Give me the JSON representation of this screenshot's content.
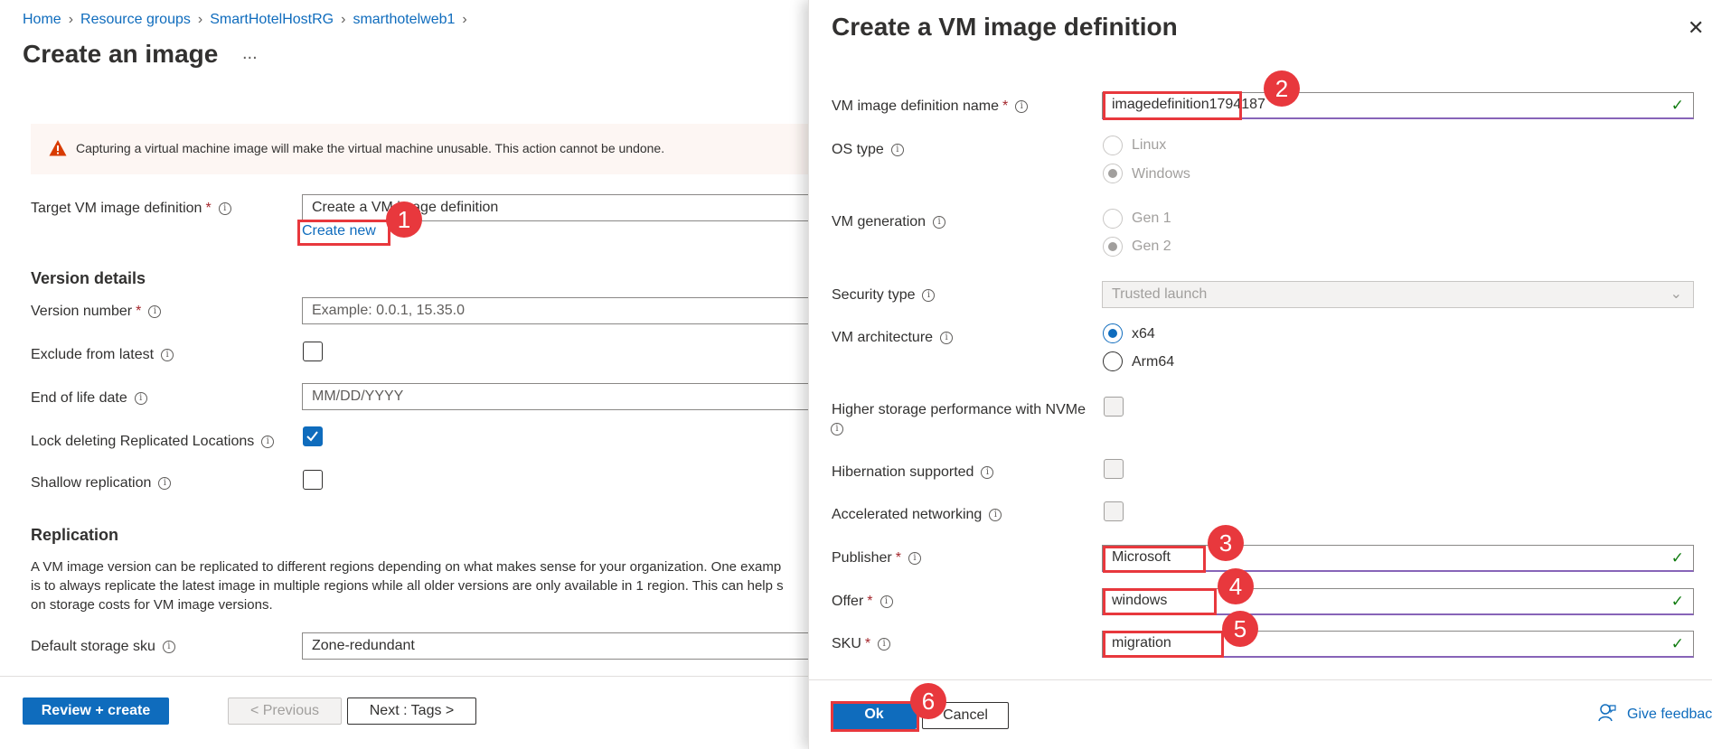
{
  "breadcrumb": [
    "Home",
    "Resource groups",
    "SmartHotelHostRG",
    "smarthotelweb1"
  ],
  "page_title": "Create an image",
  "more_icon": "...",
  "warning": "Capturing a virtual machine image will make the virtual machine unusable. This action cannot be undone.",
  "target_label": "Target VM image definition",
  "target_value": "Create a VM image definition",
  "create_new": "Create new",
  "version_heading": "Version details",
  "version_number_label": "Version number",
  "version_number_placeholder": "Example: 0.0.1, 15.35.0",
  "exclude_label": "Exclude from latest",
  "eol_label": "End of life date",
  "eol_placeholder": "MM/DD/YYYY",
  "lock_label": "Lock deleting Replicated Locations",
  "shallow_label": "Shallow replication",
  "replication_heading": "Replication",
  "replication_text_1": "A VM image version can be replicated to different regions depending on what makes sense for your organization. One examp",
  "replication_text_2": "is to always replicate the latest image in multiple regions while all older versions are only available in 1 region. This can help s",
  "replication_text_3": "on storage costs for VM image versions.",
  "storage_label": "Default storage sku",
  "storage_value": "Zone-redundant",
  "review_btn": "Review + create",
  "prev_btn": "< Previous",
  "next_btn": "Next : Tags >",
  "panel": {
    "title": "Create a VM image definition",
    "name_label": "VM image definition name",
    "name_value": "imagedefinition1794187",
    "os_label": "OS type",
    "os_options": [
      "Linux",
      "Windows"
    ],
    "gen_label": "VM generation",
    "gen_options": [
      "Gen 1",
      "Gen 2"
    ],
    "security_label": "Security type",
    "security_value": "Trusted launch",
    "arch_label": "VM architecture",
    "arch_options": [
      "x64",
      "Arm64"
    ],
    "nvme_label": "Higher storage performance with NVMe",
    "hibernation_label": "Hibernation supported",
    "accel_label": "Accelerated networking",
    "publisher_label": "Publisher",
    "publisher_value": "Microsoft",
    "offer_label": "Offer",
    "offer_value": "windows",
    "sku_label": "SKU",
    "sku_value": "migration",
    "ok_btn": "Ok",
    "cancel_btn": "Cancel",
    "feedback": "Give feedback"
  },
  "callouts": [
    "1",
    "2",
    "3",
    "4",
    "5",
    "6"
  ],
  "colors": {
    "accent": "#0f6cbd",
    "callout": "#e8383d",
    "valid": "#107c10",
    "warning": "#d83b01"
  }
}
